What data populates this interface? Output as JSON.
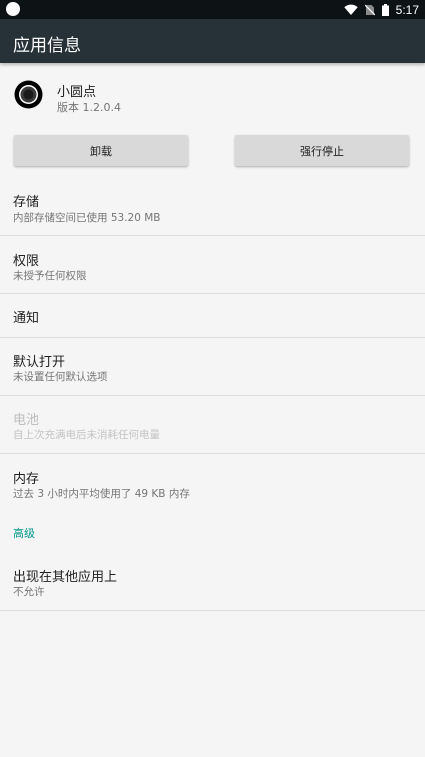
{
  "status_bar": {
    "time": "5:17",
    "icons": [
      "notification-dot-icon",
      "wifi-icon",
      "no-sim-icon",
      "battery-icon"
    ]
  },
  "app_bar": {
    "title": "应用信息",
    "background": "#263238"
  },
  "app": {
    "name": "小圆点",
    "version": "版本 1.2.0.4",
    "icon": "app-dot-icon"
  },
  "buttons": {
    "uninstall": "卸载",
    "force_stop": "强行停止"
  },
  "items": [
    {
      "title": "存储",
      "summary": "内部存储空间已使用 53.20 MB",
      "enabled": true
    },
    {
      "title": "权限",
      "summary": "未授予任何权限",
      "enabled": true
    },
    {
      "title": "通知",
      "summary": "",
      "enabled": true
    },
    {
      "title": "默认打开",
      "summary": "未设置任何默认选项",
      "enabled": true
    },
    {
      "title": "电池",
      "summary": "自上次充满电后未消耗任何电量",
      "enabled": false
    },
    {
      "title": "内存",
      "summary": "过去 3 小时内平均使用了 49 KB 内存",
      "enabled": true
    }
  ],
  "advanced": {
    "header": "高级",
    "accent": "#009688",
    "items": [
      {
        "title": "出现在其他应用上",
        "summary": "不允许"
      }
    ]
  }
}
